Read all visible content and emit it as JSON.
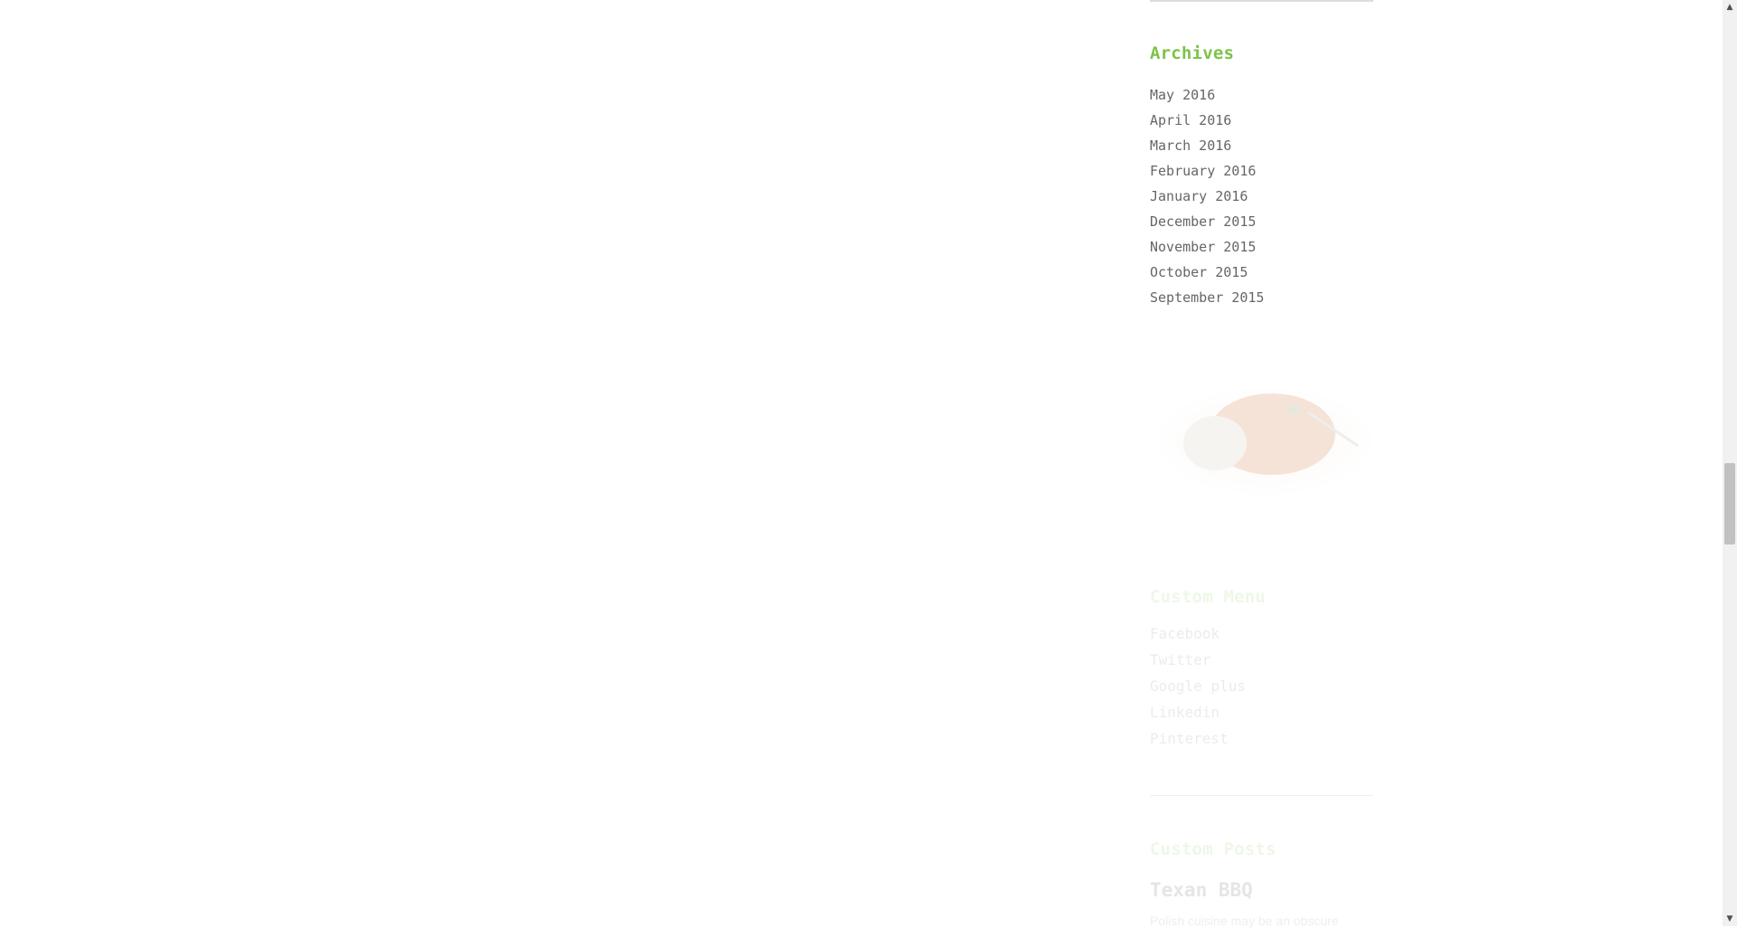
{
  "archives": {
    "title": "Archives",
    "items": [
      "May 2016",
      "April 2016",
      "March 2016",
      "February 2016",
      "January 2016",
      "December 2015",
      "November 2015",
      "October 2015",
      "September 2015"
    ]
  },
  "custom_menu": {
    "title": "Custom Menu",
    "items": [
      "Facebook",
      "Twitter",
      "Google plus",
      "Linkedin",
      "Pinterest"
    ]
  },
  "custom_posts": {
    "title": "Custom Posts",
    "post_title": "Texan BBQ",
    "excerpt": "Polish cuisine may be an obscure"
  },
  "colors": {
    "accent": "#7cc349",
    "text": "#666666"
  },
  "scrollbar": {
    "up_icon": "up-arrow-icon",
    "down_icon": "down-arrow-icon"
  }
}
